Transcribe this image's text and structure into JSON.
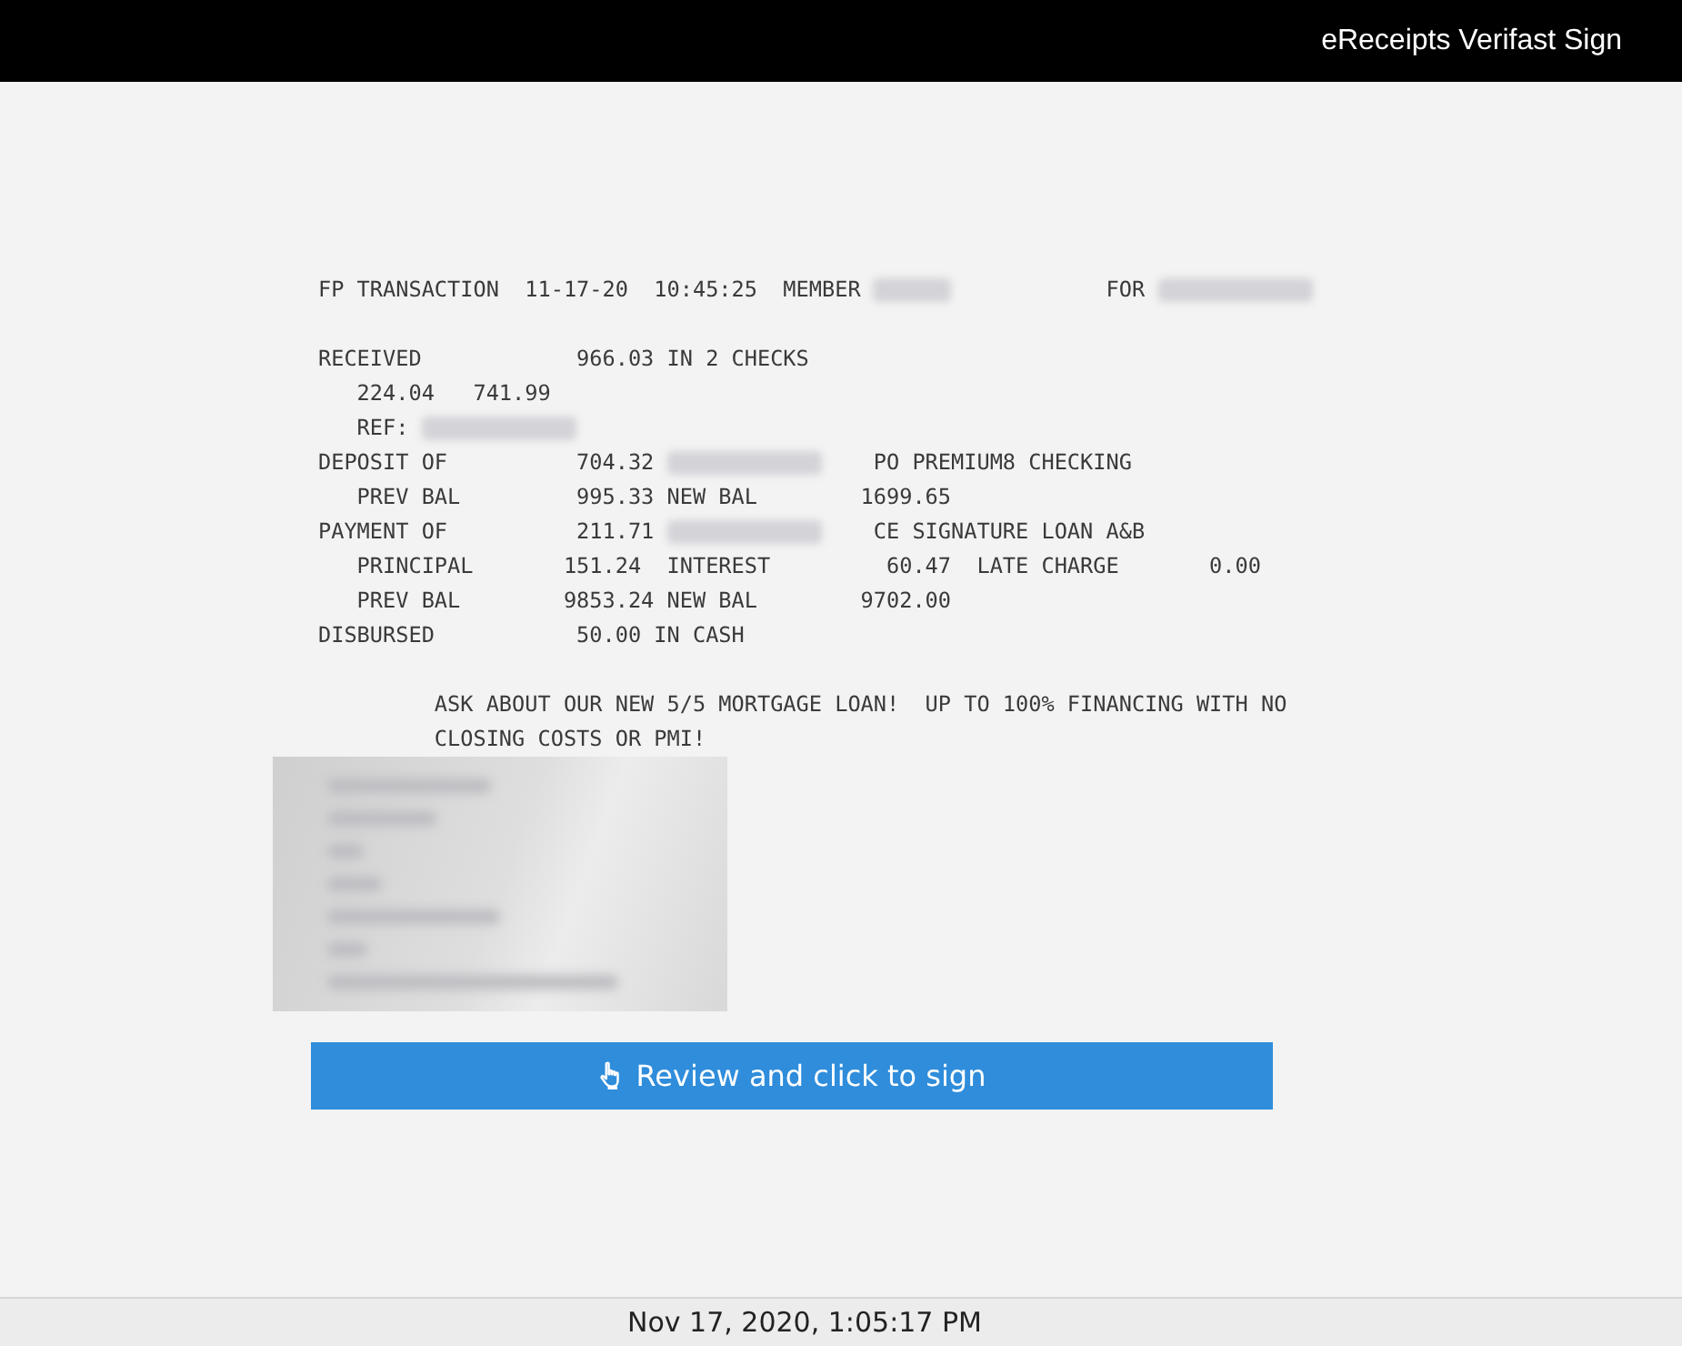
{
  "header": {
    "title": "eReceipts Verifast Sign"
  },
  "receipt": {
    "blocks": [
      [
        [
          {
            "kind": "text",
            "text": "FP TRANSACTION  11-17-20  10:45:25  MEMBER "
          },
          {
            "kind": "blur-short"
          },
          {
            "kind": "text",
            "text": "            FOR "
          },
          {
            "kind": "blur-long"
          }
        ]
      ],
      [
        [
          {
            "kind": "text",
            "text": "RECEIVED            966.03 IN 2 CHECKS"
          }
        ],
        [
          {
            "kind": "text",
            "text": "   224.04   741.99"
          }
        ],
        [
          {
            "kind": "text",
            "text": "   REF: "
          },
          {
            "kind": "blur-long"
          }
        ],
        [
          {
            "kind": "text",
            "text": "DEPOSIT OF          704.32 "
          },
          {
            "kind": "blur-long"
          },
          {
            "kind": "text",
            "text": "    PO PREMIUM8 CHECKING"
          }
        ],
        [
          {
            "kind": "text",
            "text": "   PREV BAL         995.33 NEW BAL        1699.65"
          }
        ],
        [
          {
            "kind": "text",
            "text": "PAYMENT OF          211.71 "
          },
          {
            "kind": "blur-long"
          },
          {
            "kind": "text",
            "text": "    CE SIGNATURE LOAN A&B"
          }
        ],
        [
          {
            "kind": "text",
            "text": "   PRINCIPAL       151.24  INTEREST         60.47  LATE CHARGE       0.00"
          }
        ],
        [
          {
            "kind": "text",
            "text": "   PREV BAL        9853.24 NEW BAL        9702.00"
          }
        ],
        [
          {
            "kind": "text",
            "text": "DISBURSED           50.00 IN CASH"
          }
        ]
      ],
      [
        [
          {
            "kind": "text",
            "text": "         ASK ABOUT OUR NEW 5/5 MORTGAGE LOAN!  UP TO 100% FINANCING WITH NO"
          }
        ],
        [
          {
            "kind": "text",
            "text": "         CLOSING COSTS OR PMI!"
          }
        ]
      ]
    ]
  },
  "sign_button": {
    "label": "Review and click to sign"
  },
  "footer": {
    "timestamp": "Nov 17, 2020, 1:05:17 PM"
  }
}
